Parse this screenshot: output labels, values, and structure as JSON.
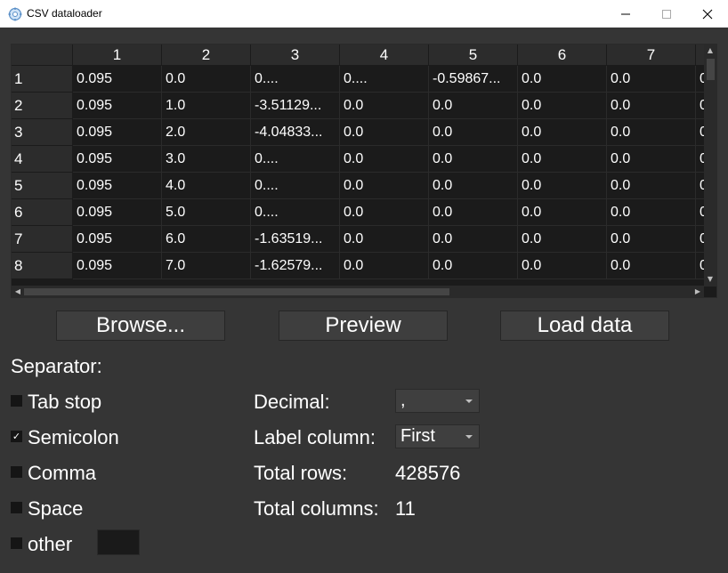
{
  "window": {
    "title": "CSV dataloader",
    "icon": "app-gear-icon"
  },
  "table": {
    "columns": [
      "1",
      "2",
      "3",
      "4",
      "5",
      "6",
      "7",
      ""
    ],
    "rows": [
      {
        "label": "1",
        "cells": [
          "0.095",
          "0.0",
          "0....",
          "0....",
          "-0.59867...",
          "0.0",
          "0.0",
          "0"
        ]
      },
      {
        "label": "2",
        "cells": [
          "0.095",
          "1.0",
          "-3.51129...",
          "0.0",
          "0.0",
          "0.0",
          "0.0",
          "0"
        ]
      },
      {
        "label": "3",
        "cells": [
          "0.095",
          "2.0",
          "-4.04833...",
          "0.0",
          "0.0",
          "0.0",
          "0.0",
          "0"
        ]
      },
      {
        "label": "4",
        "cells": [
          "0.095",
          "3.0",
          "0....",
          "0.0",
          "0.0",
          "0.0",
          "0.0",
          "0"
        ]
      },
      {
        "label": "5",
        "cells": [
          "0.095",
          "4.0",
          "0....",
          "0.0",
          "0.0",
          "0.0",
          "0.0",
          "0"
        ]
      },
      {
        "label": "6",
        "cells": [
          "0.095",
          "5.0",
          "0....",
          "0.0",
          "0.0",
          "0.0",
          "0.0",
          "0"
        ]
      },
      {
        "label": "7",
        "cells": [
          "0.095",
          "6.0",
          "-1.63519...",
          "0.0",
          "0.0",
          "0.0",
          "0.0",
          "0"
        ]
      },
      {
        "label": "8",
        "cells": [
          "0.095",
          "7.0",
          "-1.62579...",
          "0.0",
          "0.0",
          "0.0",
          "0.0",
          "0"
        ]
      }
    ]
  },
  "buttons": {
    "browse": "Browse...",
    "preview": "Preview",
    "load": "Load data"
  },
  "separator": {
    "title": "Separator:",
    "options": [
      {
        "label": "Tab stop",
        "checked": false
      },
      {
        "label": "Semicolon",
        "checked": true
      },
      {
        "label": "Comma",
        "checked": false
      },
      {
        "label": "Space",
        "checked": false
      },
      {
        "label": "other",
        "checked": false
      }
    ],
    "other_value": ""
  },
  "settings": {
    "decimal_label": "Decimal:",
    "decimal_value": ",",
    "label_column_label": "Label column:",
    "label_column_value": "First",
    "total_rows_label": "Total rows:",
    "total_rows_value": "428576",
    "total_columns_label": "Total columns:",
    "total_columns_value": "11"
  },
  "colors": {
    "background": "#353535",
    "table_bg": "#1b1b1b",
    "header_bg": "#2c2c2c",
    "text": "#ffffff"
  }
}
